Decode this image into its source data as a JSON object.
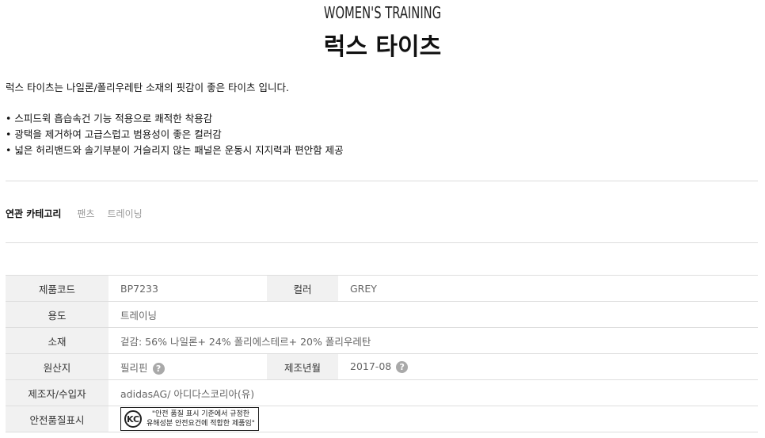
{
  "header": {
    "subtitle": "WOMEN'S TRAINING",
    "title": "럭스 타이츠"
  },
  "intro": "럭스 타이츠는 나일론/폴리우레탄 소재의 핏감이 좋은 타이츠 입니다.",
  "features": [
    "스피드윅 흡습속건 기능 적용으로 쾌적한 착용감",
    "광택을 제거하여 고급스럽고 범용성이 좋은 컬러감",
    "넓은 허리밴드와 솔기부분이 거슬리지 않는 패널은 운동시 지지력과 편안함 제공"
  ],
  "categories": {
    "label": "연관 카테고리",
    "links": [
      "팬츠",
      "트레이닝"
    ]
  },
  "specs": {
    "code_label": "제품코드",
    "code_value": "BP7233",
    "color_label": "컬러",
    "color_value": "GREY",
    "use_label": "용도",
    "use_value": "트레이닝",
    "material_label": "소재",
    "material_value": "겉감: 56% 나일론+ 24% 폴리에스테르+ 20% 폴리우레탄",
    "origin_label": "원산지",
    "origin_value": "필리핀",
    "date_label": "제조년월",
    "date_value": "2017-08",
    "maker_label": "제조자/수입자",
    "maker_value": "adidasAG/ 아디다스코리아(유)",
    "safety_label": "안전품질표시",
    "kc_logo": "KC",
    "kc_line1": "\"안전   품질 표시 기준에서 규정한",
    "kc_line2": "유해성분 안전요건에 적합한 제품임\""
  },
  "icons": {
    "help": "?"
  }
}
